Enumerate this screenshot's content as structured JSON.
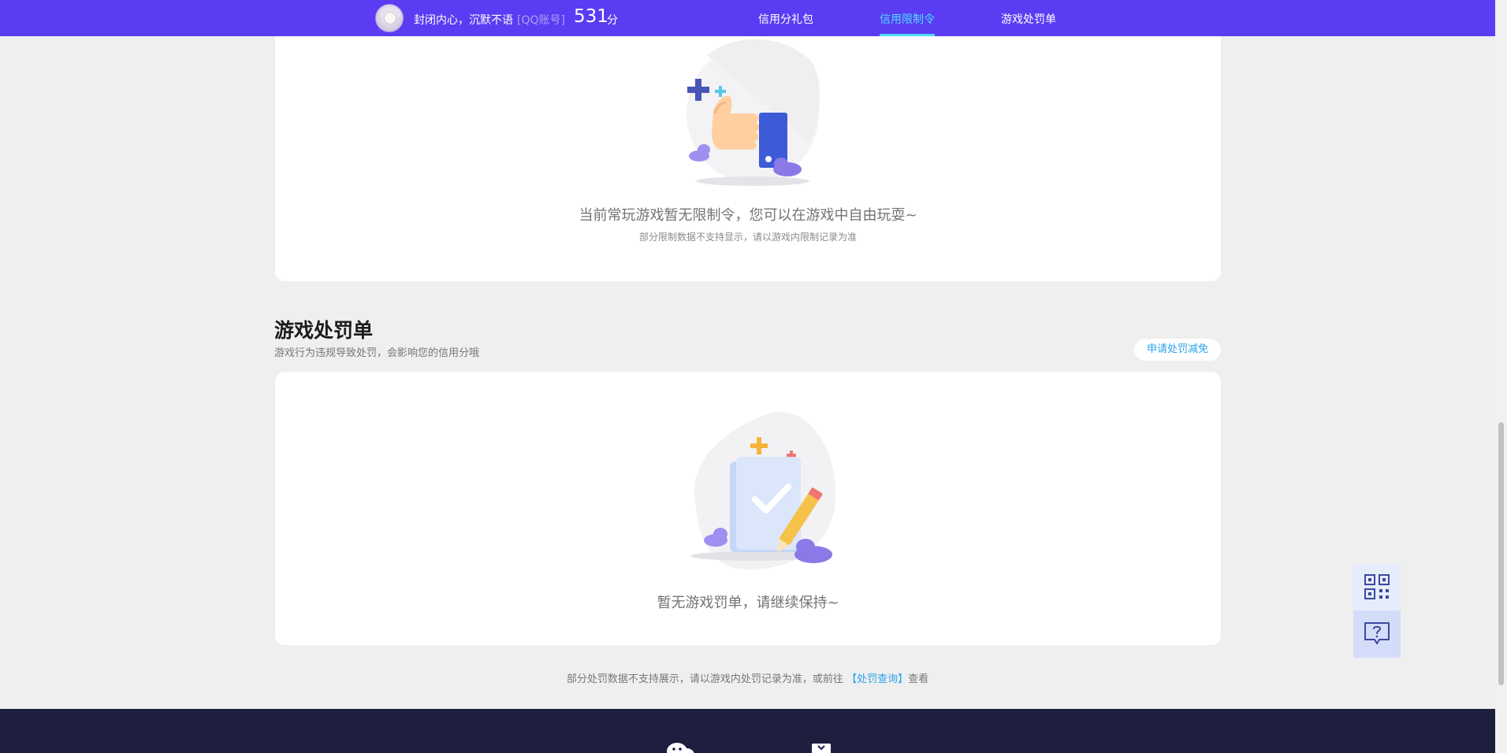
{
  "header": {
    "username": "封闭内心，沉默不语",
    "account_tag": "[QQ账号]",
    "score": "531",
    "score_unit": "分",
    "tabs": [
      {
        "label": "信用分礼包"
      },
      {
        "label": "信用限制令"
      },
      {
        "label": "游戏处罚单"
      }
    ],
    "active_tab": "信用限制令"
  },
  "restriction": {
    "message": "当前常玩游戏暂无限制令，您可以在游戏中自由玩耍~",
    "note": "部分限制数据不支持显示，请以游戏内限制记录为准"
  },
  "penalty": {
    "title": "游戏处罚单",
    "description": "游戏行为违规导致处罚，会影响您的信用分哦",
    "apply_button": "申请处罚减免",
    "empty_message": "暂无游戏罚单，请继续保持~"
  },
  "footer_note": {
    "prefix": "部分处罚数据不支持展示，请以游戏内处罚记录为准，或前往",
    "link": "【处罚查询】",
    "suffix": "查看"
  },
  "colors": {
    "nav_bg": "#5b3cf2",
    "active_tab": "#4fdcff",
    "link": "#2aa3ea",
    "page_bg": "#efefef",
    "footer_bg": "#1e1e3f"
  },
  "icons": {
    "float_top": "qr-code-icon",
    "float_bottom": "help-chat-icon",
    "footer_left": "wechat-icon",
    "footer_right": "box-icon"
  }
}
